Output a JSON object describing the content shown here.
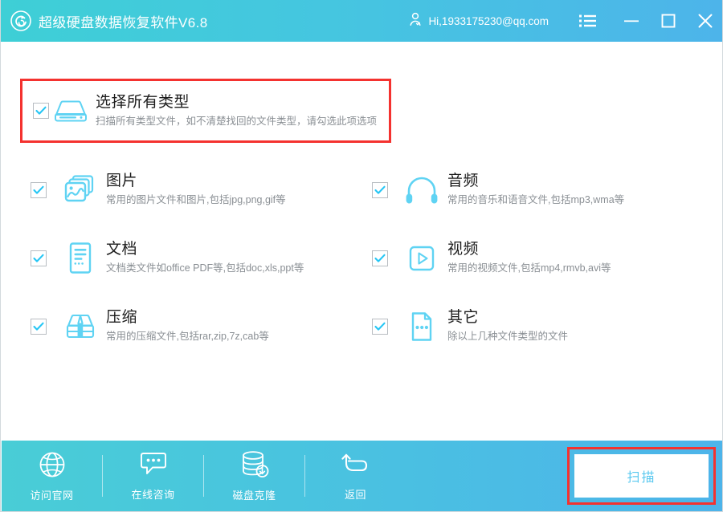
{
  "titlebar": {
    "logo_icon": "app-disc-logo-icon",
    "app_title": "超级硬盘数据恢复软件V6.8",
    "account_icon": "user-icon",
    "account_name": "Hi,1933175230@qq.com",
    "menu_icon": "list-menu-icon",
    "minimize_icon": "minimize-icon",
    "maximize_icon": "maximize-icon",
    "close_icon": "close-icon",
    "gradient_from": "#3ecfd6",
    "gradient_to": "#4db4ea"
  },
  "select_all": {
    "icon": "hard-drive-icon",
    "title": "选择所有类型",
    "desc": "扫描所有类型文件，如不清楚找回的文件类型，请勾选此项选项",
    "checked": true,
    "highlight_color": "#f4322f"
  },
  "file_types": [
    {
      "icon": "picture-icon",
      "title": "图片",
      "desc": "常用的图片文件和图片,包括jpg,png,gif等",
      "checked": true
    },
    {
      "icon": "headphones-icon",
      "title": "音频",
      "desc": "常用的音乐和语音文件,包括mp3,wma等",
      "checked": true
    },
    {
      "icon": "document-icon",
      "title": "文档",
      "desc": "文档类文件如office PDF等,包括doc,xls,ppt等",
      "checked": true
    },
    {
      "icon": "video-play-icon",
      "title": "视频",
      "desc": "常用的视频文件,包括mp4,rmvb,avi等",
      "checked": true
    },
    {
      "icon": "package-icon",
      "title": "压缩",
      "desc": "常用的压缩文件,包括rar,zip,7z,cab等",
      "checked": true
    },
    {
      "icon": "file-dots-icon",
      "title": "其它",
      "desc": "除以上几种文件类型的文件",
      "checked": true
    }
  ],
  "bottombar": {
    "items": [
      {
        "icon": "globe-icon",
        "label": "访问官网"
      },
      {
        "icon": "chat-bubble-icon",
        "label": "在线咨询"
      },
      {
        "icon": "disk-clone-icon",
        "label": "磁盘克隆"
      },
      {
        "icon": "back-arrow-icon",
        "label": "返回"
      }
    ],
    "scan_label": "扫描",
    "scan_highlight_color": "#f4322f",
    "scan_text_color": "#5ac8ef"
  },
  "theme": {
    "icon_cyan": "#5fd3f3",
    "check_cyan": "#25c6f5",
    "title_text": "#1c1c1c",
    "desc_text": "#8a8f94"
  }
}
